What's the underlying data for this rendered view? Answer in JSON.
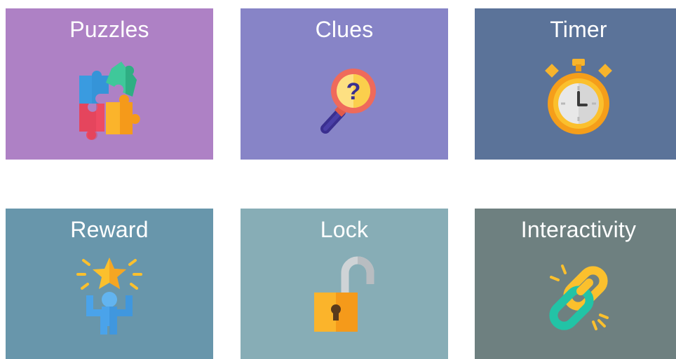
{
  "tiles": [
    {
      "label": "Puzzles",
      "icon": "puzzle-pieces-icon",
      "color": "#ae81c5"
    },
    {
      "label": "Clues",
      "icon": "magnifying-glass-question-icon",
      "color": "#8784c7"
    },
    {
      "label": "Timer",
      "icon": "stopwatch-icon",
      "color": "#5b7399"
    },
    {
      "label": "Reward",
      "icon": "person-star-reward-icon",
      "color": "#6896ab"
    },
    {
      "label": "Lock",
      "icon": "open-padlock-icon",
      "color": "#87adb6"
    },
    {
      "label": "Interactivity",
      "icon": "chain-link-icon",
      "color": "#6e8080"
    }
  ]
}
